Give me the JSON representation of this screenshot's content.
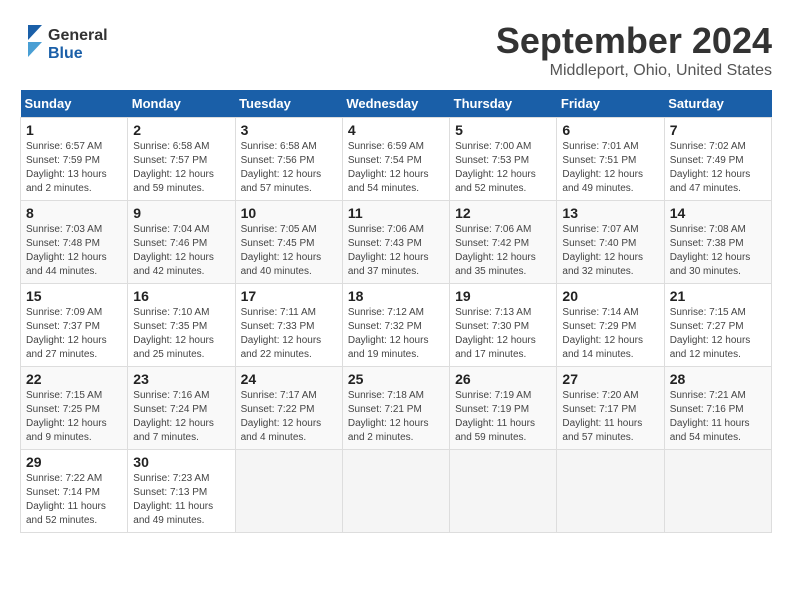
{
  "header": {
    "logo_line1": "General",
    "logo_line2": "Blue",
    "month": "September 2024",
    "location": "Middleport, Ohio, United States"
  },
  "weekdays": [
    "Sunday",
    "Monday",
    "Tuesday",
    "Wednesday",
    "Thursday",
    "Friday",
    "Saturday"
  ],
  "weeks": [
    [
      {
        "day": "1",
        "sunrise": "Sunrise: 6:57 AM",
        "sunset": "Sunset: 7:59 PM",
        "daylight": "Daylight: 13 hours and 2 minutes."
      },
      {
        "day": "2",
        "sunrise": "Sunrise: 6:58 AM",
        "sunset": "Sunset: 7:57 PM",
        "daylight": "Daylight: 12 hours and 59 minutes."
      },
      {
        "day": "3",
        "sunrise": "Sunrise: 6:58 AM",
        "sunset": "Sunset: 7:56 PM",
        "daylight": "Daylight: 12 hours and 57 minutes."
      },
      {
        "day": "4",
        "sunrise": "Sunrise: 6:59 AM",
        "sunset": "Sunset: 7:54 PM",
        "daylight": "Daylight: 12 hours and 54 minutes."
      },
      {
        "day": "5",
        "sunrise": "Sunrise: 7:00 AM",
        "sunset": "Sunset: 7:53 PM",
        "daylight": "Daylight: 12 hours and 52 minutes."
      },
      {
        "day": "6",
        "sunrise": "Sunrise: 7:01 AM",
        "sunset": "Sunset: 7:51 PM",
        "daylight": "Daylight: 12 hours and 49 minutes."
      },
      {
        "day": "7",
        "sunrise": "Sunrise: 7:02 AM",
        "sunset": "Sunset: 7:49 PM",
        "daylight": "Daylight: 12 hours and 47 minutes."
      }
    ],
    [
      {
        "day": "8",
        "sunrise": "Sunrise: 7:03 AM",
        "sunset": "Sunset: 7:48 PM",
        "daylight": "Daylight: 12 hours and 44 minutes."
      },
      {
        "day": "9",
        "sunrise": "Sunrise: 7:04 AM",
        "sunset": "Sunset: 7:46 PM",
        "daylight": "Daylight: 12 hours and 42 minutes."
      },
      {
        "day": "10",
        "sunrise": "Sunrise: 7:05 AM",
        "sunset": "Sunset: 7:45 PM",
        "daylight": "Daylight: 12 hours and 40 minutes."
      },
      {
        "day": "11",
        "sunrise": "Sunrise: 7:06 AM",
        "sunset": "Sunset: 7:43 PM",
        "daylight": "Daylight: 12 hours and 37 minutes."
      },
      {
        "day": "12",
        "sunrise": "Sunrise: 7:06 AM",
        "sunset": "Sunset: 7:42 PM",
        "daylight": "Daylight: 12 hours and 35 minutes."
      },
      {
        "day": "13",
        "sunrise": "Sunrise: 7:07 AM",
        "sunset": "Sunset: 7:40 PM",
        "daylight": "Daylight: 12 hours and 32 minutes."
      },
      {
        "day": "14",
        "sunrise": "Sunrise: 7:08 AM",
        "sunset": "Sunset: 7:38 PM",
        "daylight": "Daylight: 12 hours and 30 minutes."
      }
    ],
    [
      {
        "day": "15",
        "sunrise": "Sunrise: 7:09 AM",
        "sunset": "Sunset: 7:37 PM",
        "daylight": "Daylight: 12 hours and 27 minutes."
      },
      {
        "day": "16",
        "sunrise": "Sunrise: 7:10 AM",
        "sunset": "Sunset: 7:35 PM",
        "daylight": "Daylight: 12 hours and 25 minutes."
      },
      {
        "day": "17",
        "sunrise": "Sunrise: 7:11 AM",
        "sunset": "Sunset: 7:33 PM",
        "daylight": "Daylight: 12 hours and 22 minutes."
      },
      {
        "day": "18",
        "sunrise": "Sunrise: 7:12 AM",
        "sunset": "Sunset: 7:32 PM",
        "daylight": "Daylight: 12 hours and 19 minutes."
      },
      {
        "day": "19",
        "sunrise": "Sunrise: 7:13 AM",
        "sunset": "Sunset: 7:30 PM",
        "daylight": "Daylight: 12 hours and 17 minutes."
      },
      {
        "day": "20",
        "sunrise": "Sunrise: 7:14 AM",
        "sunset": "Sunset: 7:29 PM",
        "daylight": "Daylight: 12 hours and 14 minutes."
      },
      {
        "day": "21",
        "sunrise": "Sunrise: 7:15 AM",
        "sunset": "Sunset: 7:27 PM",
        "daylight": "Daylight: 12 hours and 12 minutes."
      }
    ],
    [
      {
        "day": "22",
        "sunrise": "Sunrise: 7:15 AM",
        "sunset": "Sunset: 7:25 PM",
        "daylight": "Daylight: 12 hours and 9 minutes."
      },
      {
        "day": "23",
        "sunrise": "Sunrise: 7:16 AM",
        "sunset": "Sunset: 7:24 PM",
        "daylight": "Daylight: 12 hours and 7 minutes."
      },
      {
        "day": "24",
        "sunrise": "Sunrise: 7:17 AM",
        "sunset": "Sunset: 7:22 PM",
        "daylight": "Daylight: 12 hours and 4 minutes."
      },
      {
        "day": "25",
        "sunrise": "Sunrise: 7:18 AM",
        "sunset": "Sunset: 7:21 PM",
        "daylight": "Daylight: 12 hours and 2 minutes."
      },
      {
        "day": "26",
        "sunrise": "Sunrise: 7:19 AM",
        "sunset": "Sunset: 7:19 PM",
        "daylight": "Daylight: 11 hours and 59 minutes."
      },
      {
        "day": "27",
        "sunrise": "Sunrise: 7:20 AM",
        "sunset": "Sunset: 7:17 PM",
        "daylight": "Daylight: 11 hours and 57 minutes."
      },
      {
        "day": "28",
        "sunrise": "Sunrise: 7:21 AM",
        "sunset": "Sunset: 7:16 PM",
        "daylight": "Daylight: 11 hours and 54 minutes."
      }
    ],
    [
      {
        "day": "29",
        "sunrise": "Sunrise: 7:22 AM",
        "sunset": "Sunset: 7:14 PM",
        "daylight": "Daylight: 11 hours and 52 minutes."
      },
      {
        "day": "30",
        "sunrise": "Sunrise: 7:23 AM",
        "sunset": "Sunset: 7:13 PM",
        "daylight": "Daylight: 11 hours and 49 minutes."
      },
      null,
      null,
      null,
      null,
      null
    ]
  ]
}
